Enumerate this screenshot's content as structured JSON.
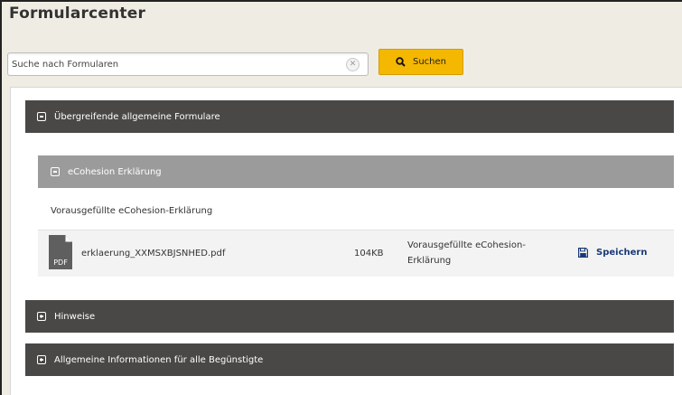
{
  "page": {
    "title": "Formularcenter"
  },
  "search": {
    "placeholder": "Suche nach Formularen",
    "value": "",
    "button_label": "Suchen"
  },
  "sections": [
    {
      "label": "Übergreifende allgemeine Formulare",
      "state": "expanded"
    },
    {
      "label": "Hinweise",
      "state": "collapsed"
    },
    {
      "label": "Allgemeine Informationen für alle Begünstigte",
      "state": "collapsed"
    }
  ],
  "subsection": {
    "label": "eCohesion Erklärung",
    "state": "expanded",
    "description": "Vorausgefüllte eCohesion-Erklärung",
    "file": {
      "type_label": "PDF",
      "name": "erklaerung_XXMSXBJSNHED.pdf",
      "size": "104KB",
      "description": "Vorausgefüllte eCohesion-Erklärung",
      "save_label": "Speichern"
    }
  },
  "colors": {
    "accent_button": "#f5b800",
    "section_bar": "#4a4846",
    "subsection_bar": "#9b9b9b",
    "link": "#1a3a78",
    "background": "#efece3"
  }
}
